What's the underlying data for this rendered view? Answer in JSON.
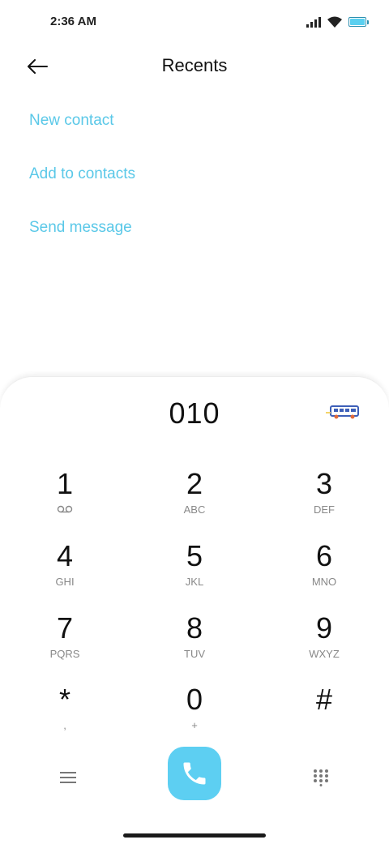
{
  "status_bar": {
    "time": "2:36 AM"
  },
  "header": {
    "title": "Recents"
  },
  "actions": [
    {
      "label": "New contact"
    },
    {
      "label": "Add to contacts"
    },
    {
      "label": "Send message"
    }
  ],
  "dialer": {
    "number": "010",
    "keys": [
      {
        "digit": "1",
        "sub": ""
      },
      {
        "digit": "2",
        "sub": "ABC"
      },
      {
        "digit": "3",
        "sub": "DEF"
      },
      {
        "digit": "4",
        "sub": "GHI"
      },
      {
        "digit": "5",
        "sub": "JKL"
      },
      {
        "digit": "6",
        "sub": "MNO"
      },
      {
        "digit": "7",
        "sub": "PQRS"
      },
      {
        "digit": "8",
        "sub": "TUV"
      },
      {
        "digit": "9",
        "sub": "WXYZ"
      },
      {
        "digit": "*",
        "sub": ","
      },
      {
        "digit": "0",
        "sub": "+"
      },
      {
        "digit": "#",
        "sub": ""
      }
    ]
  },
  "colors": {
    "accent": "#5ac8e8",
    "call_button": "#5dcff2"
  },
  "icons": {
    "back": "arrow-left-icon",
    "voicemail": "voicemail-icon",
    "menu": "menu-icon",
    "call": "phone-icon",
    "keypad": "keypad-icon",
    "bus": "bus-icon",
    "signal": "signal-icon",
    "wifi": "wifi-icon",
    "battery": "battery-icon"
  }
}
